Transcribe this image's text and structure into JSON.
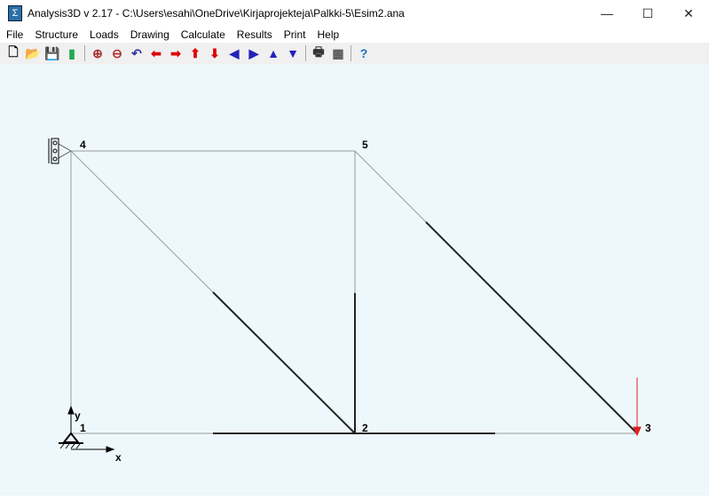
{
  "window": {
    "title": "Analysis3D v 2.17  - C:\\Users\\esahi\\OneDrive\\Kirjaprojekteja\\Palkki-5\\Esim2.ana",
    "minimize": "—",
    "maximize": "☐",
    "close": "✕"
  },
  "menu": [
    "File",
    "Structure",
    "Loads",
    "Drawing",
    "Calculate",
    "Results",
    "Print",
    "Help"
  ],
  "toolbar": [
    {
      "name": "new-icon",
      "glyph": "🗋",
      "color": "#000"
    },
    {
      "name": "open-icon",
      "glyph": "📂",
      "color": "#c9a400"
    },
    {
      "name": "save-icon",
      "glyph": "💾",
      "color": "#333"
    },
    {
      "name": "chart-icon",
      "glyph": "▮",
      "color": "#2a5"
    },
    {
      "sep": true
    },
    {
      "name": "zoom-in-icon",
      "glyph": "⊕",
      "color": "#a33"
    },
    {
      "name": "zoom-out-icon",
      "glyph": "⊖",
      "color": "#a33"
    },
    {
      "name": "undo-icon",
      "glyph": "↶",
      "color": "#33a"
    },
    {
      "name": "pan-left-icon",
      "glyph": "⬅",
      "color": "#d00"
    },
    {
      "name": "pan-right-icon",
      "glyph": "➡",
      "color": "#d00"
    },
    {
      "name": "pan-up-icon",
      "glyph": "⬆",
      "color": "#d00"
    },
    {
      "name": "pan-down-icon",
      "glyph": "⬇",
      "color": "#d00"
    },
    {
      "name": "rotate-left-icon",
      "glyph": "◀",
      "color": "#22b"
    },
    {
      "name": "rotate-right-icon",
      "glyph": "▶",
      "color": "#22b"
    },
    {
      "name": "rotate-up-icon",
      "glyph": "▲",
      "color": "#22b"
    },
    {
      "name": "rotate-down-icon",
      "glyph": "▼",
      "color": "#22b"
    },
    {
      "sep": true
    },
    {
      "name": "print-icon",
      "glyph": "🖶",
      "color": "#333"
    },
    {
      "name": "calculator-icon",
      "glyph": "▦",
      "color": "#555"
    },
    {
      "sep": true
    },
    {
      "name": "help-icon",
      "glyph": "?",
      "color": "#1a6fc0"
    }
  ],
  "nodes": [
    {
      "label": "1"
    },
    {
      "label": "2"
    },
    {
      "label": "3"
    },
    {
      "label": "4"
    },
    {
      "label": "5"
    }
  ],
  "axes": {
    "x": "x",
    "y": "y"
  },
  "colors": {
    "canvas": "#eef8fc",
    "member": "#999999",
    "member_stressed": "#222222",
    "load": "#e02020"
  }
}
